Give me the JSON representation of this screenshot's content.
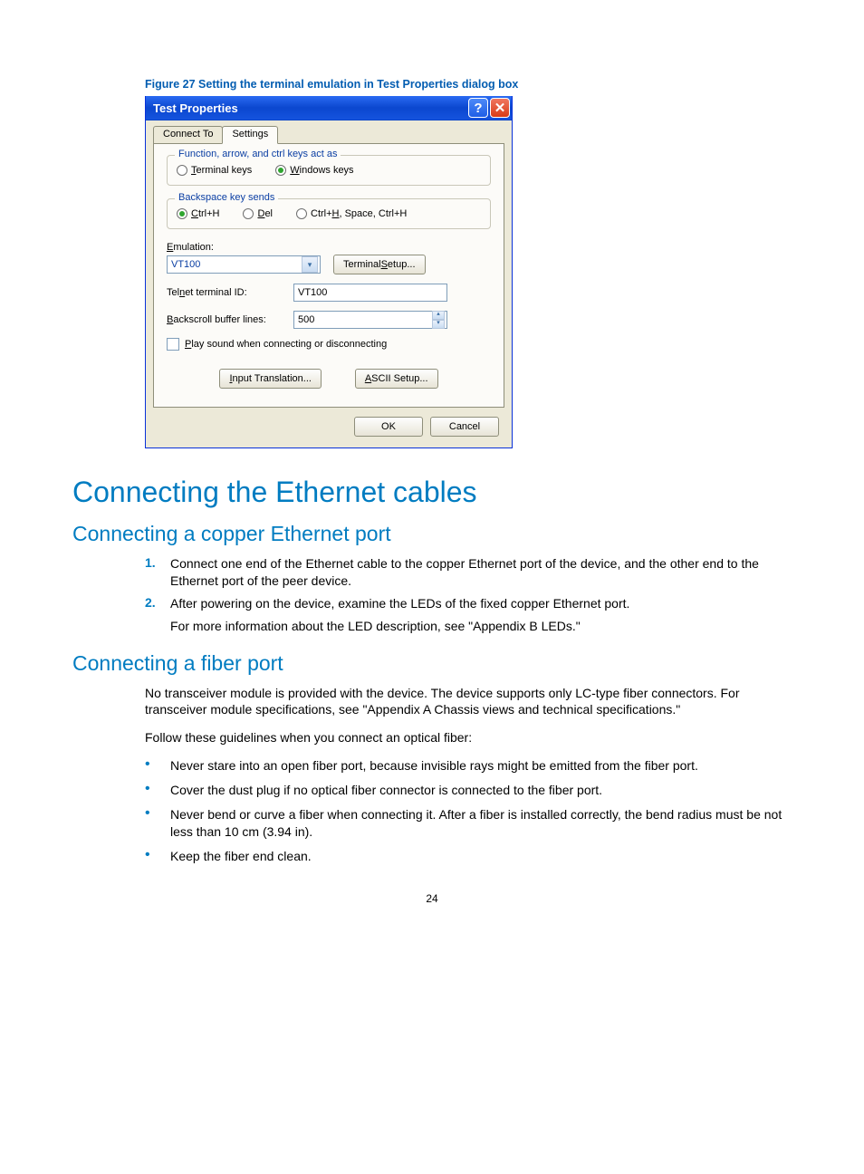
{
  "figure_caption": "Figure 27 Setting the terminal emulation in Test Properties dialog box",
  "dialog": {
    "title": "Test Properties",
    "tabs": {
      "connect_to": "Connect To",
      "settings": "Settings"
    },
    "group1": {
      "legend": "Function, arrow, and ctrl keys act as",
      "opt_terminal_pre": "T",
      "opt_terminal_post": "erminal keys",
      "opt_windows_pre": "W",
      "opt_windows_post": "indows keys"
    },
    "group2": {
      "legend": "Backspace key sends",
      "opt_a_pre": "C",
      "opt_a_post": "trl+H",
      "opt_b_pre": "D",
      "opt_b_post": "el",
      "opt_c_prefix": "Ctrl+",
      "opt_c_u": "H",
      "opt_c_post": ", Space, Ctrl+H"
    },
    "emulation_label_pre": "E",
    "emulation_label_post": "mulation:",
    "emulation_value": "VT100",
    "terminal_setup_btn_pre": "Terminal ",
    "terminal_setup_btn_u": "S",
    "terminal_setup_btn_post": "etup...",
    "telnet_label_pre": "Tel",
    "telnet_label_u": "n",
    "telnet_label_post": "et terminal ID:",
    "telnet_value": "VT100",
    "backscroll_label_u": "B",
    "backscroll_label_post": "ackscroll buffer lines:",
    "backscroll_value": "500",
    "play_sound_u": "P",
    "play_sound_post": "lay sound when connecting or disconnecting",
    "input_translation_u": "I",
    "input_translation_post": "nput Translation...",
    "ascii_setup_u": "A",
    "ascii_setup_post": "SCII Setup...",
    "ok": "OK",
    "cancel": "Cancel"
  },
  "doc": {
    "h1": "Connecting the Ethernet cables",
    "h2a": "Connecting a copper Ethernet port",
    "ol": {
      "n1": "1.",
      "t1": "Connect one end of the Ethernet cable to the copper Ethernet port of the device, and the other end to the Ethernet port of the peer device.",
      "n2": "2.",
      "t2": "After powering on the device, examine the LEDs of the fixed copper Ethernet port.",
      "t2b": "For more information about the LED description, see \"Appendix B LEDs.\""
    },
    "h2b": "Connecting a fiber port",
    "p1": "No transceiver module is provided with the device. The device supports only LC-type fiber connectors. For transceiver module specifications, see \"Appendix A Chassis views and technical specifications.\"",
    "p2": "Follow these guidelines when you connect an optical fiber:",
    "ul": {
      "b1": "Never stare into an open fiber port, because invisible rays might be emitted from the fiber port.",
      "b2": "Cover the dust plug if no optical fiber connector is connected to the fiber port.",
      "b3": "Never bend or curve a fiber when connecting it. After a fiber is installed correctly, the bend radius must be not less than 10 cm (3.94 in).",
      "b4": "Keep the fiber end clean."
    },
    "page_number": "24"
  }
}
